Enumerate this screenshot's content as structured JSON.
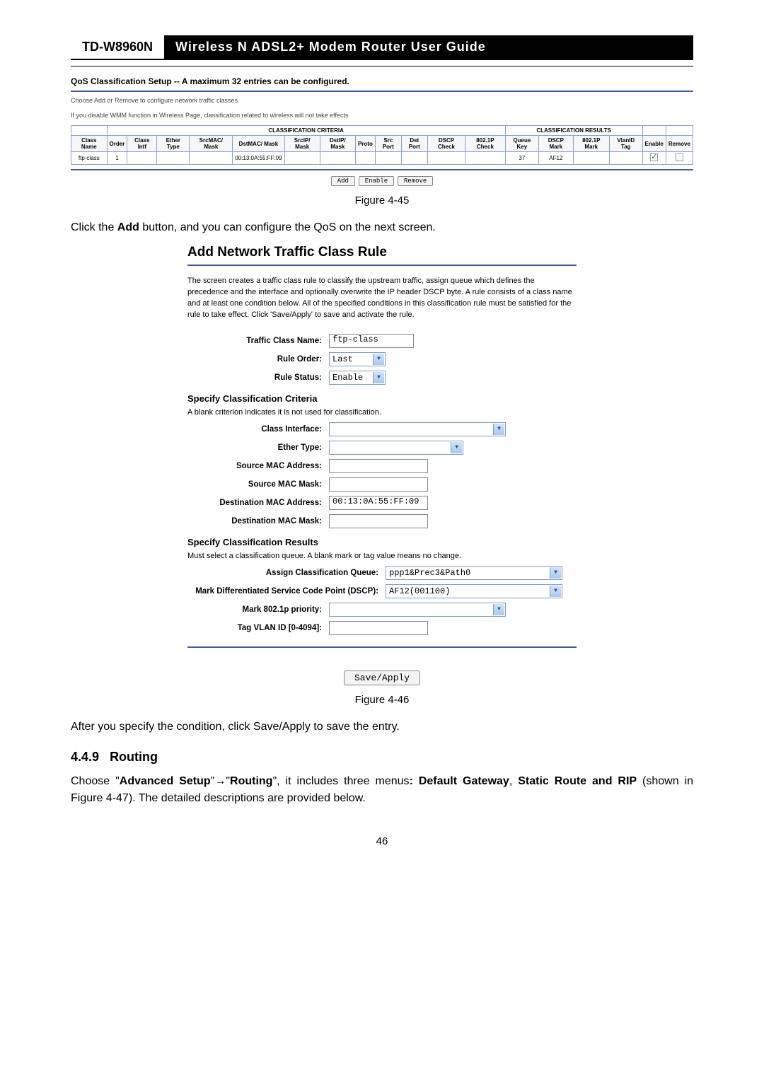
{
  "header": {
    "model": "TD-W8960N",
    "title": "Wireless  N  ADSL2+  Modem  Router  User  Guide"
  },
  "fig45": {
    "title": "QoS Classification Setup -- A maximum 32 entries can be configured.",
    "note1": "Choose Add or Remove to configure network traffic classes.",
    "note2": "If you disable WMM function in Wireless Page, classification related to wireless will not take effects",
    "group1": "CLASSIFICATION CRITERIA",
    "group2": "CLASSIFICATION RESULTS",
    "cols": {
      "c0": "Class Name",
      "c1": "Order",
      "c2": "Class Intf",
      "c3": "Ether Type",
      "c4": "SrcMAC/ Mask",
      "c5": "DstMAC/ Mask",
      "c6": "SrcIP/ Mask",
      "c7": "DstIP/ Mask",
      "c8": "Proto",
      "c9": "Src Port",
      "c10": "Dst Port",
      "c11": "DSCP Check",
      "c12": "802.1P Check",
      "c13": "Queue Key",
      "c14": "DSCP Mark",
      "c15": "802.1P Mark",
      "c16": "VlanID Tag",
      "c17": "Enable",
      "c18": "Remove"
    },
    "row": {
      "class_name": "ftp-class",
      "order": "1",
      "class_intf": "",
      "ether_type": "",
      "srcmac": "",
      "dstmac": "00:13:0A:55:FF:09",
      "srcip": "",
      "dstip": "",
      "proto": "",
      "srcport": "",
      "dstport": "",
      "dscp_check": "",
      "p_check": "",
      "queue_key": "37",
      "dscp_mark": "AF12",
      "p_mark": "",
      "vlanid": ""
    },
    "buttons": {
      "add": "Add",
      "enable": "Enable",
      "remove": "Remove"
    },
    "caption": "Figure 4-45"
  },
  "text1_a": "Click the ",
  "text1_b": "Add",
  "text1_c": " button, and you can configure the QoS on the next screen.",
  "fig46": {
    "heading": "Add Network Traffic Class Rule",
    "desc": "The screen creates a traffic class rule to classify the upstream traffic, assign queue which defines the precedence and the interface and optionally overwrite the IP header DSCP byte. A rule consists of a class name and at least one condition below. All of the specified conditions in this classification rule must be satisfied for the rule to take effect. Click 'Save/Apply' to save and activate the rule.",
    "labels": {
      "tcn": "Traffic Class Name:",
      "ro": "Rule Order:",
      "rs": "Rule Status:",
      "scc": "Specify Classification Criteria",
      "scc_note": "A blank criterion indicates it is not used for classification.",
      "ci": "Class Interface:",
      "et": "Ether Type:",
      "sma": "Source MAC Address:",
      "smm": "Source MAC Mask:",
      "dma": "Destination MAC Address:",
      "dmm": "Destination MAC Mask:",
      "scr": "Specify Classification Results",
      "scr_note": "Must select a classification queue. A blank mark or tag value means no change.",
      "acq": "Assign Classification Queue:",
      "mdscp": "Mark Differentiated Service Code Point (DSCP):",
      "m8021p": "Mark 802.1p priority:",
      "tvlan": "Tag VLAN ID [0-4094]:"
    },
    "values": {
      "tcn": "ftp-class",
      "ro": "Last",
      "rs": "Enable",
      "dma": "00:13:0A:55:FF:09",
      "acq": "ppp1&Prec3&Path0",
      "mdscp": "AF12(001100)"
    },
    "save": "Save/Apply",
    "caption": "Figure 4-46"
  },
  "text2": "After you specify the condition, click Save/Apply to save the entry.",
  "section": {
    "num": "4.4.9",
    "title": "Routing"
  },
  "text3_parts": {
    "a": "Choose \"",
    "b": "Advanced Setup",
    "c": "\"",
    "arrow": "→",
    "d": "\"",
    "e": "Routing",
    "f": "\", it includes three menus",
    "g": ": Default Gateway",
    "h": ", ",
    "i": "Static Route and RIP",
    "j": " (shown in Figure 4-47). The detailed descriptions are provided below."
  },
  "page_number": "46"
}
